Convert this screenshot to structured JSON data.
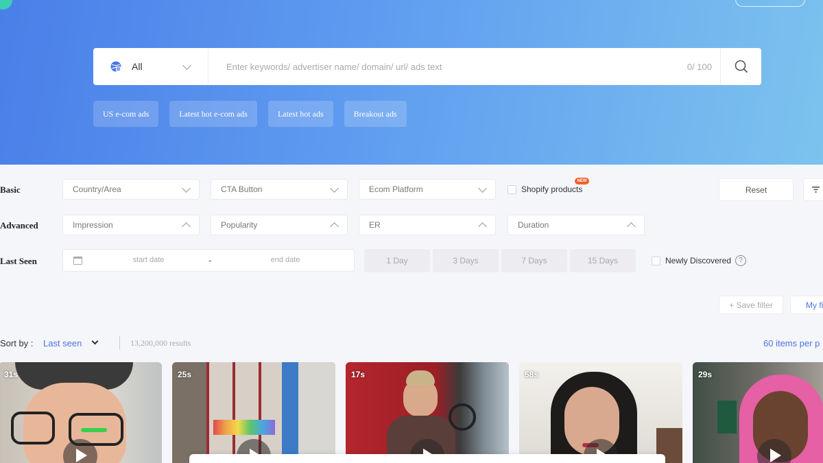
{
  "colors": {
    "accent": "#4a73e8",
    "hero_start": "#4a7fe8",
    "hero_end": "#7cc3ee",
    "new_badge": "#f0622f"
  },
  "search": {
    "scope_icon": "globe-icon",
    "scope_label": "All",
    "placeholder": "Enter keywords/ advertiser name/ domain/ url/ ads text",
    "value": "",
    "counter": "0/ 100",
    "submit_icon": "search-icon"
  },
  "quick_tags": [
    "US e-com ads",
    "Latest hot e-com ads",
    "Latest hot ads",
    "Breakout ads"
  ],
  "filters": {
    "basic": {
      "label": "Basic",
      "country": "Country/Area",
      "cta": "CTA Button",
      "platform": "Ecom Platform",
      "shopify_label": "Shopify products",
      "new_badge": "NEW"
    },
    "advanced": {
      "label": "Advanced",
      "impression": "Impression",
      "popularity": "Popularity",
      "er": "ER",
      "duration": "Duration"
    },
    "last_seen": {
      "label": "Last Seen",
      "start_placeholder": "start date",
      "separator": "-",
      "end_placeholder": "end date",
      "days": [
        "1 Day",
        "3 Days",
        "7 Days",
        "15 Days"
      ],
      "newly_label": "Newly Discovered",
      "help": "?"
    },
    "reset": "Reset",
    "save_filter": "+ Save filter",
    "my_filters": "My fil"
  },
  "sort": {
    "label": "Sort by :",
    "value": "Last seen",
    "results": "13,200,000 results",
    "per_page": "60 items per p"
  },
  "cards": [
    {
      "duration": "31s"
    },
    {
      "duration": "25s"
    },
    {
      "duration": "17s"
    },
    {
      "duration": "58s"
    },
    {
      "duration": "29s"
    }
  ]
}
